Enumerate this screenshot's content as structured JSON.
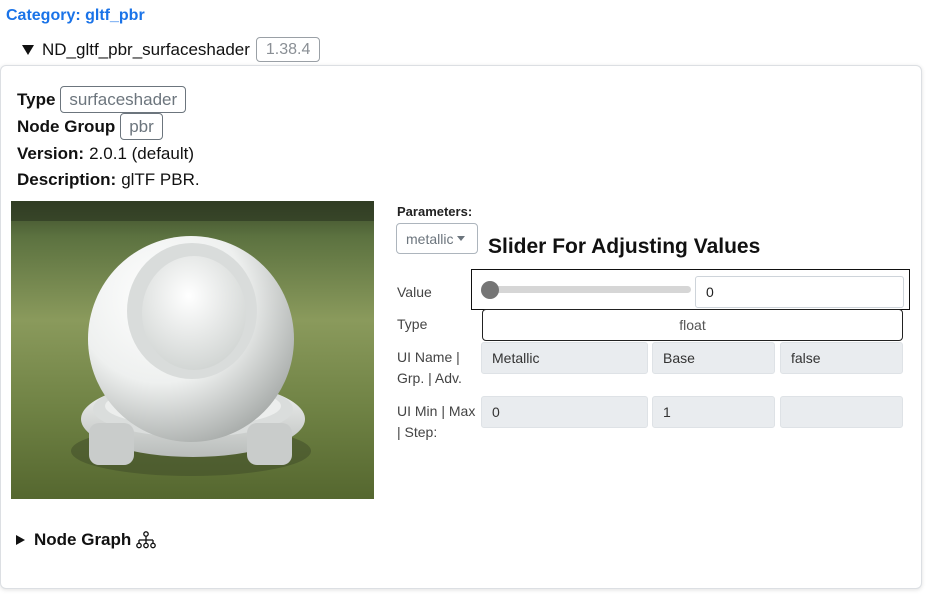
{
  "category": "Category: gltf_pbr",
  "node": {
    "name": "ND_gltf_pbr_surfaceshader",
    "version": "1.38.4"
  },
  "meta": {
    "type_label": "Type",
    "type_value": "surfaceshader",
    "group_label": "Node Group",
    "group_value": "pbr",
    "version_label": "Version:",
    "version_value": "2.0.1 (default)",
    "desc_label": "Description:",
    "desc_value": "glTF PBR."
  },
  "preview": {
    "icon": "material-sphere-preview"
  },
  "params": {
    "label": "Parameters:",
    "selected": "metallic",
    "callout": "Slider For Adjusting Values",
    "value_label": "Value",
    "value": "0",
    "slider_fraction": 0,
    "type_label": "Type",
    "type_value": "float",
    "uiname_label_1": "UI Name |",
    "uiname_label_2": "Grp. | Adv.",
    "ui_name": "Metallic",
    "ui_group": "Base",
    "ui_adv": "false",
    "uimin_label_1": "UI Min | Max",
    "uimin_label_2": "| Step:",
    "ui_min": "0",
    "ui_max": "1",
    "ui_step": ""
  },
  "node_graph": {
    "label": "Node Graph",
    "icon": "node-graph-icon"
  }
}
